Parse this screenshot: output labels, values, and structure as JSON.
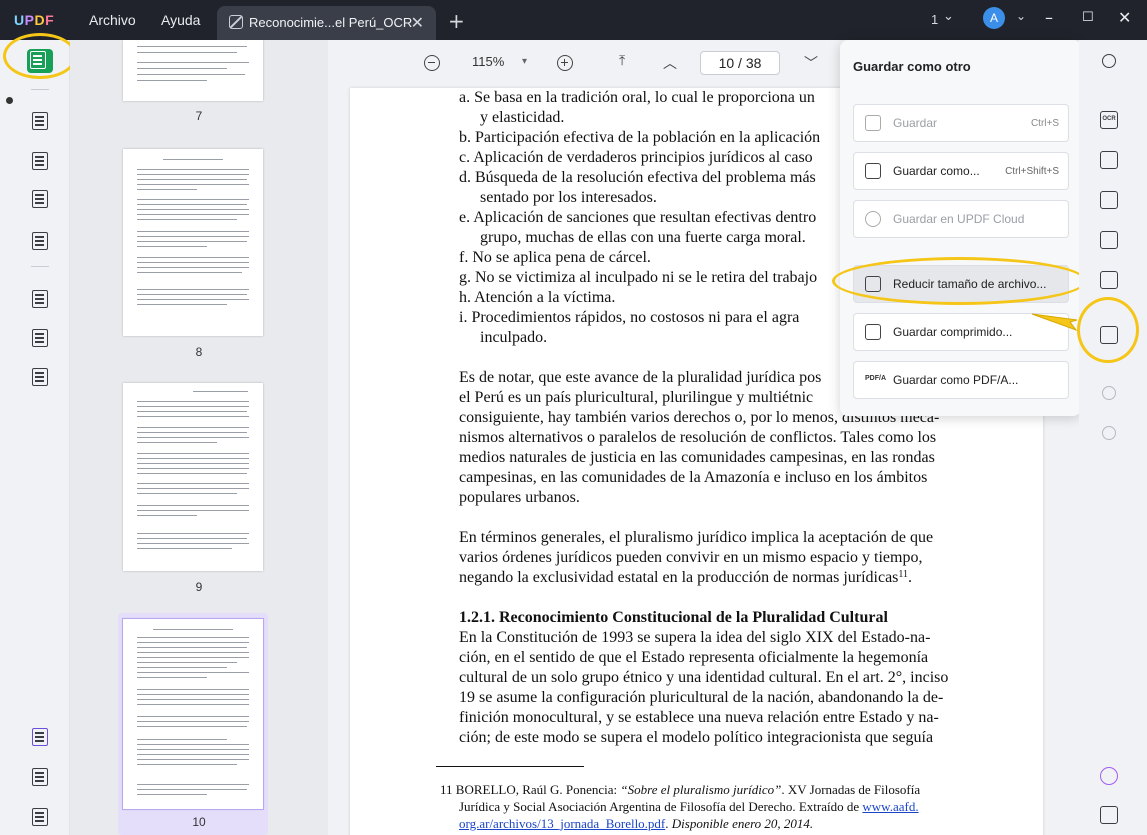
{
  "app": {
    "logo": {
      "l1": "U",
      "l2": "P",
      "l3": "D",
      "l4": "F"
    },
    "menu": [
      "Archivo",
      "Ayuda"
    ],
    "tab": {
      "title": "Reconocimie...el Perú_OCR",
      "close": "✕"
    },
    "new_tab": "+",
    "tab_count": "1",
    "avatar": "A"
  },
  "toolbar": {
    "zoom": "115%",
    "zoom_caret": "▾",
    "page_indicator": "10  /  38"
  },
  "thumbnails": {
    "pages": [
      "7",
      "8",
      "9",
      "10"
    ],
    "selected": "10"
  },
  "document": {
    "lines": [
      "a.  Se basa en la tradición oral, lo cual le proporciona un",
      "y elasticidad.",
      "b.  Participación efectiva de la población en la aplicación",
      "c.  Aplicación de verdaderos principios jurídicos al caso",
      "d.  Búsqueda de la resolución efectiva del problema más",
      "sentado por los interesados.",
      "e.  Aplicación de sanciones que resultan efectivas dentro",
      "grupo, muchas de ellas con una fuerte carga moral.",
      "f.   No se aplica pena de cárcel.",
      "g.  No se victimiza al inculpado ni se le retira del trabajo",
      "h. Atención a la víctima.",
      "i.   Procedimientos rápidos, no costosos ni para el agra",
      "inculpado."
    ],
    "para1": [
      "Es de notar, que este avance de la pluralidad jurídica pos",
      "el Perú es un país pluricultural, plurilingue y multiétnic",
      "consiguiente, hay también varios derechos o, por lo menos, distintos meca-",
      "nismos alternativos o paralelos de resolución de conflictos. Tales como los",
      "medios naturales de justicia en las comunidades campesinas, en las rondas",
      "campesinas, en las comunidades de la Amazonía e incluso en los ámbitos",
      "populares urbanos."
    ],
    "para2": [
      "En términos generales, el pluralismo jurídico implica la aceptación de que",
      "varios órdenes jurídicos pueden convivir en un mismo espacio y tiempo,",
      "negando la exclusividad estatal en la producción de normas jurídicas"
    ],
    "para2_sup": "11",
    "para2_end": ".",
    "heading": "1.2.1. Reconocimiento Constitucional de la Pluralidad Cultural",
    "para3": [
      "En la Constitución de 1993 se supera la idea del siglo XIX del Estado-na-",
      "ción, en el sentido de que el Estado representa oficialmente la hegemonía",
      "cultural de un solo grupo étnico y una identidad cultural. En el art. 2°, inciso",
      "19 se asume la configuración pluricultural de la nación, abandonando la de-",
      "finición monocultural, y se establece una nueva relación entre Estado y na-",
      "ción; de este modo se supera el modelo político integracionista que seguía"
    ],
    "footnote": {
      "l1a": "11 BORELLO, Raúl G. Ponencia: ",
      "l1b": "“Sobre el pluralismo jurídico”",
      "l1c": ". XV Jornadas de Filosofía",
      "l2a": "Jurídica y Social Asociación Argentina de Filosofía del Derecho. Extraído de ",
      "l2b": "www.aafd.",
      "l3a": "org.ar/archivos/13_jornada_Borello.pdf",
      "l3b": ". ",
      "l3c": "Disponible enero 20, 2014."
    }
  },
  "save_menu": {
    "title": "Guardar como otro",
    "items": [
      {
        "label": "Guardar",
        "shortcut": "Ctrl+S",
        "disabled": true
      },
      {
        "label": "Guardar como...",
        "shortcut": "Ctrl+Shift+S",
        "disabled": false
      },
      {
        "label": "Guardar en UPDF Cloud",
        "shortcut": "",
        "disabled": true
      },
      {
        "label": "Reducir tamaño de archivo...",
        "shortcut": "",
        "disabled": false
      },
      {
        "label": "Guardar comprimido...",
        "shortcut": "",
        "disabled": false
      },
      {
        "label": "Guardar como PDF/A...",
        "shortcut": "",
        "disabled": false
      }
    ],
    "pdf_badge": "PDF/A"
  },
  "right_toolbar": {
    "ocr_label": "OCR"
  },
  "colors": {
    "titlebar": "#20232b",
    "accent_green": "#18a058",
    "highlight_yellow": "#f5c518",
    "thumb_selected": "#e4defa",
    "link": "#1a44c8"
  },
  "icons": [
    "search-icon",
    "ocr-icon",
    "convert-icon",
    "protect-icon",
    "share-icon",
    "mail-icon",
    "save-icon",
    "undo-icon",
    "redo-icon",
    "comment-icon",
    "zoom-out-icon",
    "zoom-in-icon",
    "first-page-icon",
    "prev-page-icon",
    "next-page-icon"
  ]
}
